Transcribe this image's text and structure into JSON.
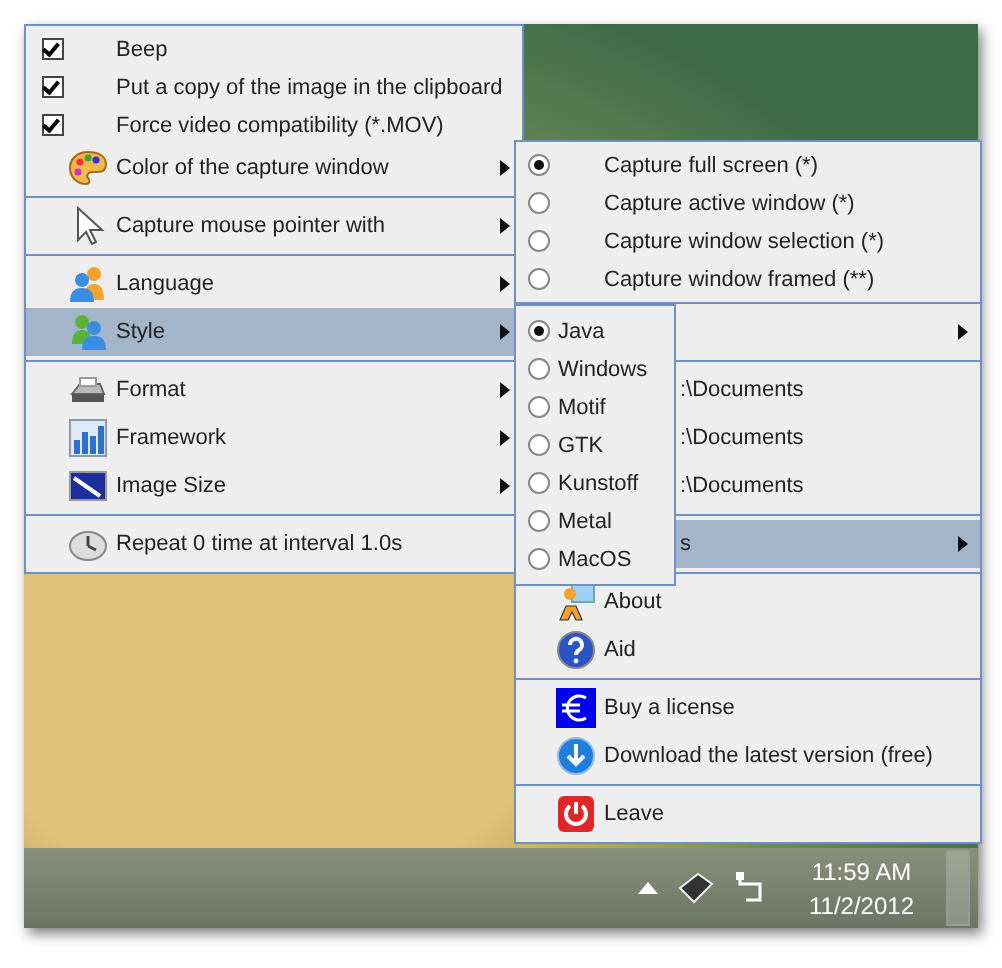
{
  "main_menu": {
    "items": [
      {
        "kind": "check",
        "label": "Beep",
        "checked": true
      },
      {
        "kind": "check",
        "label": "Put a copy of the image in the clipboard",
        "checked": true
      },
      {
        "kind": "check",
        "label": "Force video compatibility (*.MOV)",
        "checked": true
      },
      {
        "kind": "submenu",
        "label": "Color of the capture window",
        "highlighted": false
      },
      {
        "kind": "separator"
      },
      {
        "kind": "submenu",
        "label": "Capture mouse pointer with",
        "highlighted": false
      },
      {
        "kind": "separator"
      },
      {
        "kind": "submenu",
        "label": "Language",
        "highlighted": false
      },
      {
        "kind": "submenu",
        "label": "Style",
        "highlighted": true
      },
      {
        "kind": "separator"
      },
      {
        "kind": "submenu",
        "label": "Format",
        "highlighted": false
      },
      {
        "kind": "submenu",
        "label": "Framework",
        "highlighted": false
      },
      {
        "kind": "submenu",
        "label": "Image Size",
        "highlighted": false
      },
      {
        "kind": "separator"
      },
      {
        "kind": "action",
        "label": "Repeat 0 time at interval 1.0s",
        "highlighted": false
      }
    ]
  },
  "capture_menu": {
    "items": [
      {
        "kind": "radio",
        "label": "Capture full screen (*)",
        "selected": true
      },
      {
        "kind": "radio",
        "label": "Capture active window (*)",
        "selected": false
      },
      {
        "kind": "radio",
        "label": "Capture window selection (*)",
        "selected": false
      },
      {
        "kind": "radio",
        "label": "Capture window framed (**)",
        "selected": false
      },
      {
        "kind": "separator"
      },
      {
        "kind": "submenu",
        "highlighted": false
      },
      {
        "kind": "separator"
      },
      {
        "kind": "action",
        "label": ":\\Documents",
        "highlighted": false
      },
      {
        "kind": "action",
        "label": ":\\Documents",
        "highlighted": false
      },
      {
        "kind": "action",
        "label": ":\\Documents",
        "highlighted": false
      },
      {
        "kind": "separator"
      },
      {
        "kind": "submenu",
        "label": "s",
        "highlighted": true
      },
      {
        "kind": "separator"
      },
      {
        "kind": "action",
        "label": "About",
        "highlighted": false
      },
      {
        "kind": "action",
        "label": "Aid",
        "highlighted": false
      },
      {
        "kind": "separator"
      },
      {
        "kind": "action",
        "label": "Buy a license",
        "highlighted": false
      },
      {
        "kind": "action",
        "label": "Download the latest version (free)",
        "highlighted": false
      },
      {
        "kind": "separator"
      },
      {
        "kind": "action",
        "label": "Leave",
        "highlighted": false
      }
    ]
  },
  "style_menu": {
    "items": [
      {
        "label": "Java",
        "selected": true
      },
      {
        "label": "Windows",
        "selected": false
      },
      {
        "label": "Motif",
        "selected": false
      },
      {
        "label": "GTK",
        "selected": false
      },
      {
        "label": "Kunstoff",
        "selected": false
      },
      {
        "label": "Metal",
        "selected": false
      },
      {
        "label": "MacOS",
        "selected": false
      }
    ]
  },
  "taskbar": {
    "time": "11:59 AM",
    "date": "11/2/2012"
  }
}
